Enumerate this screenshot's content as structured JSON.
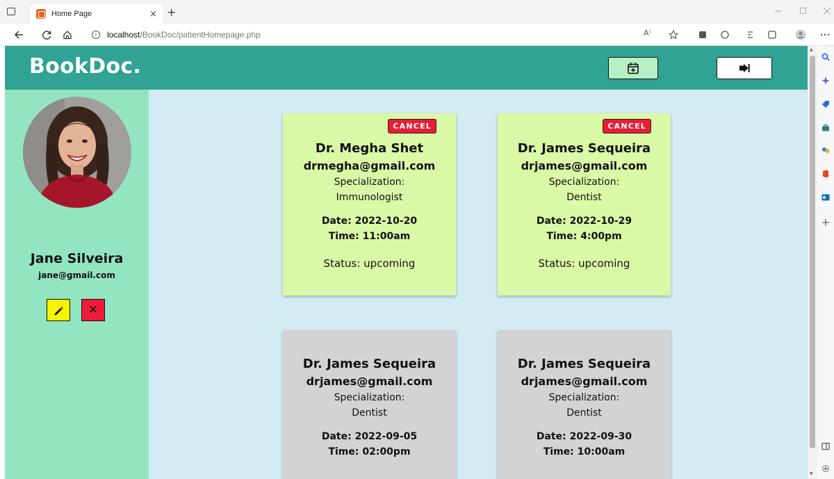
{
  "browser": {
    "tab_title": "Home Page",
    "tab_close": "×",
    "new_tab": "+",
    "url_host": "localhost",
    "url_path": "/BookDoc/patientHomepage.php",
    "read_aloud": "A⁾"
  },
  "app": {
    "brand": "BookDoc.",
    "colors": {
      "navbar": "#31a394",
      "sidebar": "#93e5c2",
      "main": "#d3ebf3",
      "upcoming_card": "#daf9a6",
      "past_card": "#d3d3d3",
      "cancel": "#e81d35"
    }
  },
  "user": {
    "name": "Jane Silveira",
    "email": "jane@gmail.com",
    "delete_label": "✕"
  },
  "appointments": [
    {
      "cancel_label": "CANCEL",
      "doctor": "Dr. Megha Shet",
      "email": "drmegha@gmail.com",
      "spec_label": "Specialization:",
      "specialization": "Immunologist",
      "date": "Date: 2022-10-20",
      "time": "Time: 11:00am",
      "status": "Status: upcoming"
    },
    {
      "cancel_label": "CANCEL",
      "doctor": "Dr. James Sequeira",
      "email": "drjames@gmail.com",
      "spec_label": "Specialization:",
      "specialization": "Dentist",
      "date": "Date: 2022-10-29",
      "time": "Time: 4:00pm",
      "status": "Status: upcoming"
    },
    {
      "doctor": "Dr. James Sequeira",
      "email": "drjames@gmail.com",
      "spec_label": "Specialization:",
      "specialization": "Dentist",
      "date": "Date: 2022-09-05",
      "time": "Time: 02:00pm"
    },
    {
      "doctor": "Dr. James Sequeira",
      "email": "drjames@gmail.com",
      "spec_label": "Specialization:",
      "specialization": "Dentist",
      "date": "Date: 2022-09-30",
      "time": "Time: 10:00am"
    }
  ]
}
